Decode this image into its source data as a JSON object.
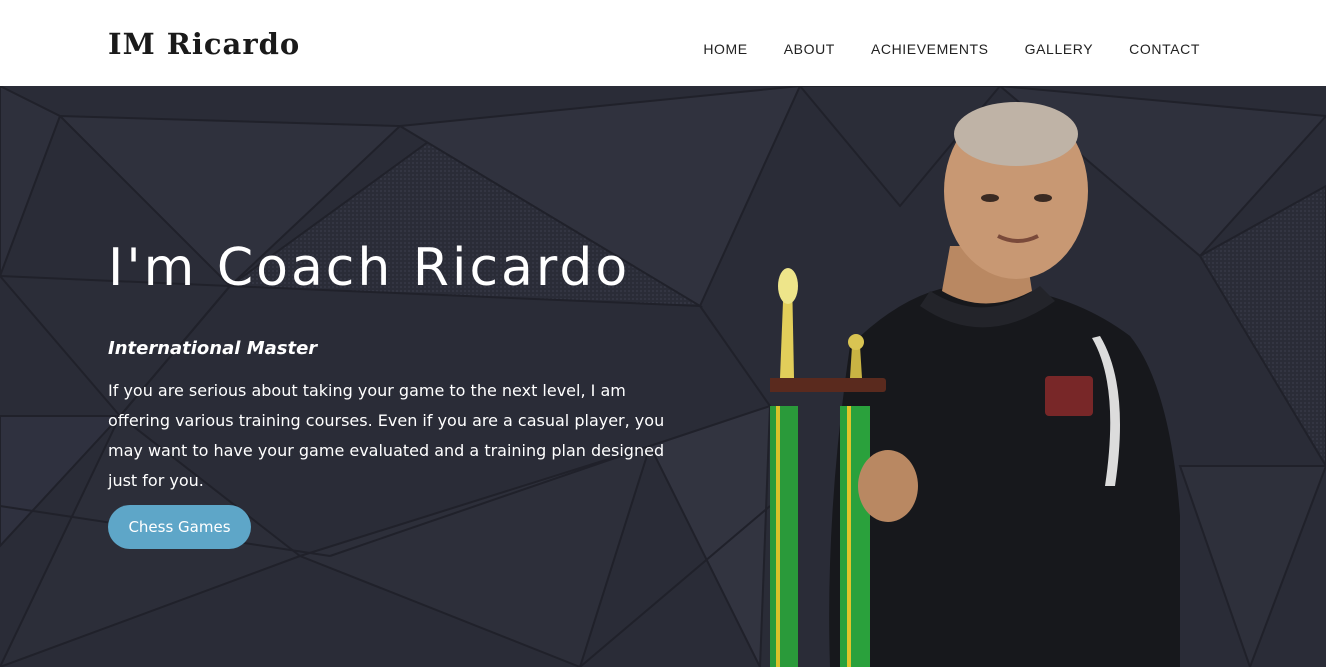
{
  "site": {
    "logo": "IM Ricardo"
  },
  "nav": {
    "items": [
      {
        "label": "HOME",
        "name": "nav-home"
      },
      {
        "label": "ABOUT",
        "name": "nav-about"
      },
      {
        "label": "ACHIEVEMENTS",
        "name": "nav-achievements"
      },
      {
        "label": "GALLERY",
        "name": "nav-gallery"
      },
      {
        "label": "CONTACT",
        "name": "nav-contact"
      }
    ]
  },
  "hero": {
    "headline": "I'm Coach Ricardo",
    "subtitle": "International Master",
    "paragraph": "If you are serious about taking your game to the next level, I am offering various training courses. Even if you are a casual player, you may want to have your game evaluated and a training plan designed just for you.",
    "cta_label": "Chess Games"
  },
  "colors": {
    "header_bg": "#ffffff",
    "hero_bg": "#2a2c37",
    "accent": "#5ea6c8",
    "text_light": "#ffffff",
    "text_dark": "#1a1a1a"
  }
}
